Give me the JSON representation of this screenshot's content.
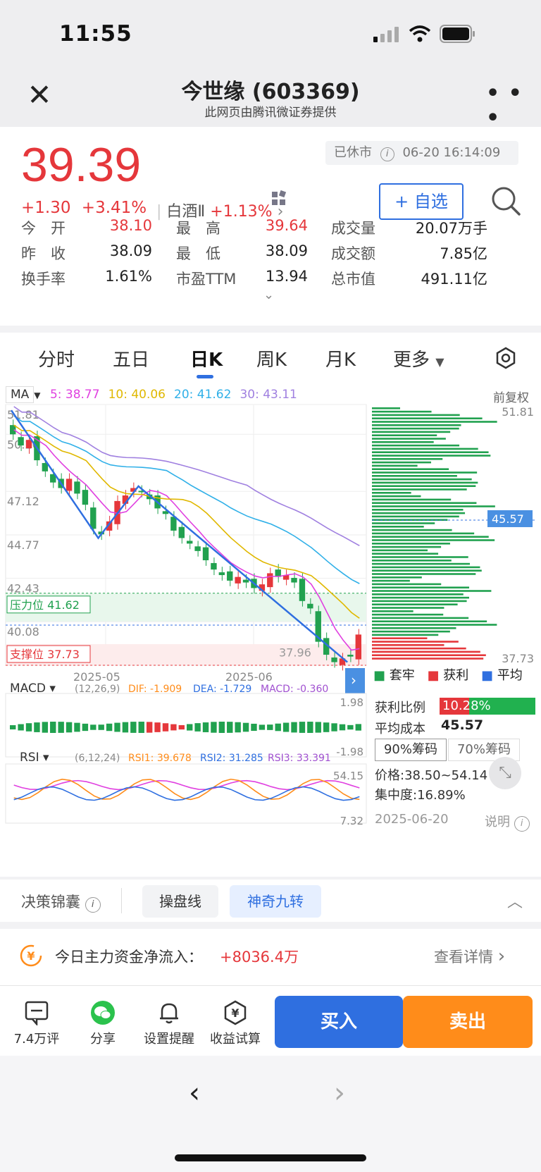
{
  "status_bar": {
    "time": "11:55"
  },
  "nav": {
    "title": "今世缘 (603369)",
    "subtitle": "此网页由腾讯微证券提供"
  },
  "quote": {
    "price": "39.39",
    "change": "+1.30",
    "change_pct": "+3.41%",
    "sector_name": "白酒Ⅱ",
    "sector_pct": "+1.13%",
    "market_status": "已休市",
    "timestamp": "06-20 16:14:09",
    "watch_label": "+ 自选",
    "stats": [
      {
        "label": "今　开",
        "value": "38.10",
        "color": "#e5373b"
      },
      {
        "label": "最　高",
        "value": "39.64",
        "color": "#e5373b"
      },
      {
        "label": "成交量",
        "value": "20.07万手",
        "color": "#222222"
      },
      {
        "label": "昨　收",
        "value": "38.09",
        "color": "#222222"
      },
      {
        "label": "最　低",
        "value": "38.09",
        "color": "#222222"
      },
      {
        "label": "成交额",
        "value": "7.85亿",
        "color": "#222222"
      },
      {
        "label": "换手率",
        "value": "1.61%",
        "color": "#222222"
      },
      {
        "label": "市盈TTM",
        "value": "13.94",
        "color": "#222222"
      },
      {
        "label": "总市值",
        "value": "491.11亿",
        "color": "#222222"
      }
    ]
  },
  "tabs": [
    "分时",
    "五日",
    "日K",
    "周K",
    "月K",
    "更多"
  ],
  "active_tab": "日K",
  "ma_legend": {
    "label": "MA",
    "items": [
      {
        "name": "5:",
        "value": "38.77",
        "color": "#e040e0"
      },
      {
        "name": "10:",
        "value": "40.06",
        "color": "#e0b800"
      },
      {
        "name": "20:",
        "value": "41.62",
        "color": "#30b0e8"
      },
      {
        "name": "30:",
        "value": "43.11",
        "color": "#a080e0"
      }
    ],
    "adjust": "前复权"
  },
  "chart_data": {
    "type": "candlestick",
    "price_ticks": [
      "51.81",
      "50.20",
      "47.12",
      "44.77",
      "42.43",
      "40.08"
    ],
    "x_ticks": [
      "2025-05",
      "2025-06"
    ],
    "resistance": {
      "label": "压力位",
      "value": "41.62"
    },
    "support": {
      "label": "支撑位",
      "value": "37.73"
    },
    "low_mark": "37.96",
    "profile_high": "51.81",
    "profile_low": "37.73",
    "avg_cost_mark": "45.57",
    "closes": [
      50.2,
      49.6,
      49.9,
      48.8,
      48.2,
      47.6,
      47.3,
      47.8,
      47.0,
      46.4,
      45.1,
      44.8,
      45.5,
      46.6,
      46.9,
      47.3,
      47.1,
      46.7,
      46.2,
      45.9,
      45.0,
      44.6,
      44.3,
      43.9,
      43.4,
      42.9,
      42.6,
      42.3,
      42.5,
      42.2,
      41.9,
      42.1,
      42.7,
      42.5,
      42.6,
      42.2,
      41.2,
      40.8,
      39.0,
      38.3,
      37.9,
      38.1,
      38.2,
      39.39
    ]
  },
  "macd": {
    "label": "MACD",
    "params": "(12,26,9)",
    "dif": "DIF: -1.909",
    "dea": "DEA: -1.729",
    "macd": "MACD: -0.360",
    "top": "1.98",
    "bottom": "-1.98"
  },
  "rsi": {
    "label": "RSI",
    "params": "(6,12,24)",
    "rsi1": "RSI1: 39.678",
    "rsi2": "RSI2: 31.285",
    "rsi3": "RSI3: 33.391",
    "top": "54.15",
    "bottom": "7.32"
  },
  "chip": {
    "legend": [
      "套牢",
      "获利",
      "平均"
    ],
    "profit_ratio_label": "获利比例",
    "profit_ratio": "10.28%",
    "avg_cost_label": "平均成本",
    "avg_cost": "45.57",
    "btn90": "90%筹码",
    "btn70": "70%筹码",
    "range": "价格:38.50~54.14",
    "concentration": "集中度:16.89%",
    "date": "2025-06-20",
    "explain": "说明"
  },
  "decision": {
    "label": "决策锦囊",
    "btn1": "操盘线",
    "btn2": "神奇九转"
  },
  "flow": {
    "label": "今日主力资金净流入：",
    "value": "+8036.4万",
    "link": "查看详情"
  },
  "actions": {
    "comments": "7.4万评",
    "share": "分享",
    "alert": "设置提醒",
    "calc": "收益试算",
    "buy": "买入",
    "sell": "卖出"
  }
}
